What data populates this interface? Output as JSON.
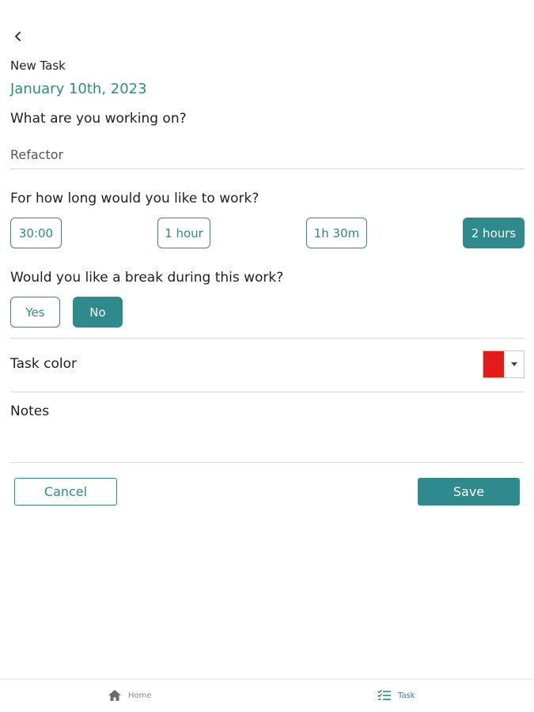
{
  "header": {
    "back_icon": "chevron-left-icon",
    "title": "New Task",
    "date": "January 10th, 2023"
  },
  "task": {
    "question": "What are you working on?",
    "value": "Refactor"
  },
  "duration": {
    "question": "For how long would you like to work?",
    "options": [
      "30:00",
      "1 hour",
      "1h 30m",
      "2 hours"
    ],
    "selected": "2 hours"
  },
  "break": {
    "question": "Would you like a break during this work?",
    "options": [
      "Yes",
      "No"
    ],
    "selected": "No"
  },
  "color": {
    "label": "Task color",
    "value": "#e31b1b",
    "dropdown_icon": "caret-down-icon"
  },
  "notes": {
    "label": "Notes",
    "value": ""
  },
  "actions": {
    "cancel_label": "Cancel",
    "save_label": "Save"
  },
  "nav": {
    "items": [
      {
        "label": "Home",
        "icon": "home-icon",
        "active": false
      },
      {
        "label": "Task",
        "icon": "task-list-icon",
        "active": true
      }
    ]
  },
  "colors": {
    "accent": "#2e8a8c",
    "divider": "#d9d9d9",
    "text": "#1f1f1f",
    "muted": "#8a8a8a"
  }
}
